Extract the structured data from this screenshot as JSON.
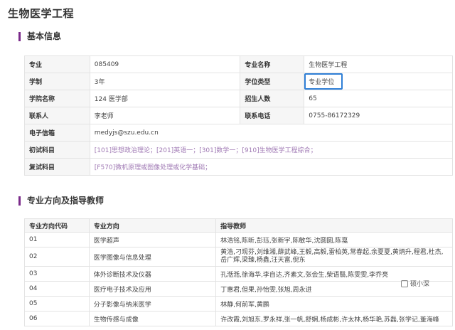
{
  "page": {
    "title": "生物医学工程"
  },
  "basic": {
    "title": "基本信息",
    "rows": [
      {
        "l1": "专业",
        "v1": "085409",
        "l2": "专业名称",
        "v2": "生物医学工程"
      },
      {
        "l1": "学制",
        "v1": "3年",
        "l2": "学位类型",
        "v2": "专业学位"
      },
      {
        "l1": "学院名称",
        "v1": "124 医学部",
        "l2": "招生人数",
        "v2": "65"
      },
      {
        "l1": "联系人",
        "v1": "李老师",
        "l2": "联系电话",
        "v2": "0755-86172329"
      }
    ],
    "email": {
      "label": "电子信箱",
      "value": "medyjs@szu.edu.cn"
    },
    "exam1": {
      "label": "初试科目",
      "value": "[101]思想政治理论；[201]英语一；[301]数学一；[910]生物医学工程综合；"
    },
    "exam2": {
      "label": "复试科目",
      "value": "[F570]微机原理或图像处理或化学基础；"
    }
  },
  "directions": {
    "title": "专业方向及指导教师",
    "headers": [
      "专业方向代码",
      "专业方向",
      "指导教师"
    ],
    "rows": [
      {
        "code": "01",
        "name": "医学超声",
        "teachers": "林浩铭,陈昕,彭珏,张新宇,陈敏华,沈圆圆,陈戛"
      },
      {
        "code": "02",
        "name": "医学图像与信息处理",
        "teachers": "黄浩,刁现芬,刘维湘,薛武峰,王毅,高毅,雷柏英,常春起,余夏夏,黄炳升,程君,杜杰,岳广辉,梁臻,杨鑫,汪天富,倪东"
      },
      {
        "code": "03",
        "name": "体外诊断技术及仪器",
        "teachers": "孔湉湉,徐海华,李自达,齐素文,张会生,柴语翳,陈雯雯,李乔亮"
      },
      {
        "code": "04",
        "name": "医疗电子技术及应用",
        "teachers": "丁惠君,但果,孙怡雯,张旭,周永进"
      },
      {
        "code": "05",
        "name": "分子影像与纳米医学",
        "teachers": "林静,何前军,黄鹏"
      },
      {
        "code": "06",
        "name": "生物传感与成像",
        "teachers": "许改霞,刘旭东,罗永祥,张一帆,舒娴,杨成彬,许太林,杨华艳,苏磊,张学记,董海峰"
      }
    ]
  },
  "watermark": {
    "text": "硕小深",
    "icon": "watermark-logo-icon"
  }
}
